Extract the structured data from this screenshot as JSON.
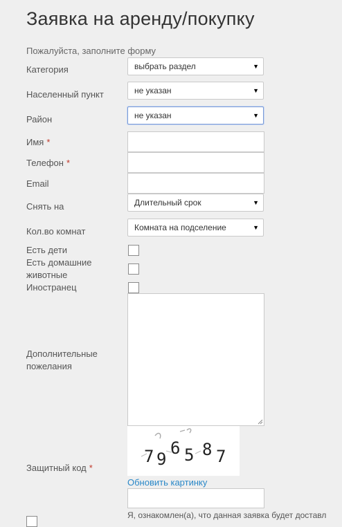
{
  "page": {
    "title": "Заявка на аренду/покупку",
    "intro": "Пожалуйста, заполните форму"
  },
  "colors": {
    "required": "#c0392b",
    "link": "#2a88c8",
    "focus": "#7b9bd6"
  },
  "form": {
    "category": {
      "label": "Категория",
      "value": "выбрать раздел"
    },
    "city": {
      "label": "Населенный пункт",
      "value": "не указан"
    },
    "district": {
      "label": "Район",
      "value": "не указан"
    },
    "name": {
      "label": "Имя",
      "required_mark": "*",
      "value": ""
    },
    "phone": {
      "label": "Телефон",
      "required_mark": "*",
      "value": ""
    },
    "email": {
      "label": "Email",
      "value": ""
    },
    "rent_for": {
      "label": "Снять на",
      "value": "Длительный срок"
    },
    "rooms": {
      "label": "Кол.во комнат",
      "value": "Комната на подселение"
    },
    "children": {
      "label": "Есть дети",
      "checked": false
    },
    "pets": {
      "label_line1": "Есть домашние",
      "label_line2": "животные",
      "checked": false
    },
    "foreigner": {
      "label": "Иностранец",
      "checked": false
    },
    "wishes": {
      "label_line1": "Дополнительные",
      "label_line2": "пожелания",
      "value": ""
    },
    "captcha": {
      "label": "Защитный код",
      "required_mark": "*",
      "code": "796587",
      "refresh_link": "Обновить картинку",
      "value": ""
    },
    "agreement": {
      "text": "Я, ознакомлен(а), что данная заявка будет доставл",
      "checked": false
    }
  },
  "icons": {
    "dropdown": "triangle-down-icon",
    "resize": "resize-grip-icon"
  }
}
